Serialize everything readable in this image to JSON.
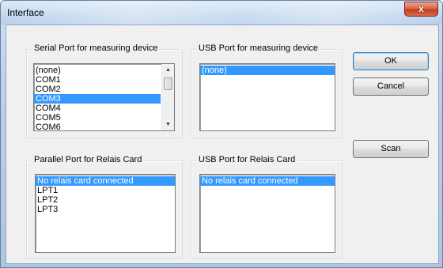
{
  "window": {
    "title": "Interface",
    "close_glyph": "x"
  },
  "groups": {
    "serial": {
      "label": "Serial Port for measuring device",
      "items": [
        "(none)",
        "COM1",
        "COM2",
        "COM3",
        "COM4",
        "COM5",
        "COM6"
      ],
      "selected": "COM3"
    },
    "usb_measuring": {
      "label": "USB Port for measuring device",
      "items": [
        "(none)"
      ],
      "selected": "(none)"
    },
    "parallel": {
      "label": "Parallel Port for Relais Card",
      "items": [
        "No relais card connected",
        "LPT1",
        "LPT2",
        "LPT3"
      ],
      "selected": "No relais card connected"
    },
    "usb_relais": {
      "label": "USB Port for Relais Card",
      "items": [
        "No relais card connected"
      ],
      "selected": "No relais card connected"
    }
  },
  "buttons": {
    "ok": "OK",
    "cancel": "Cancel",
    "scan": "Scan"
  },
  "icons": {
    "close": "close-icon",
    "scroll_up": "arrow-up-icon",
    "scroll_down": "arrow-down-icon"
  },
  "colors": {
    "selection": "#3399ff",
    "close_button": "#c43d1e",
    "dialog_face": "#f0f0f0"
  }
}
